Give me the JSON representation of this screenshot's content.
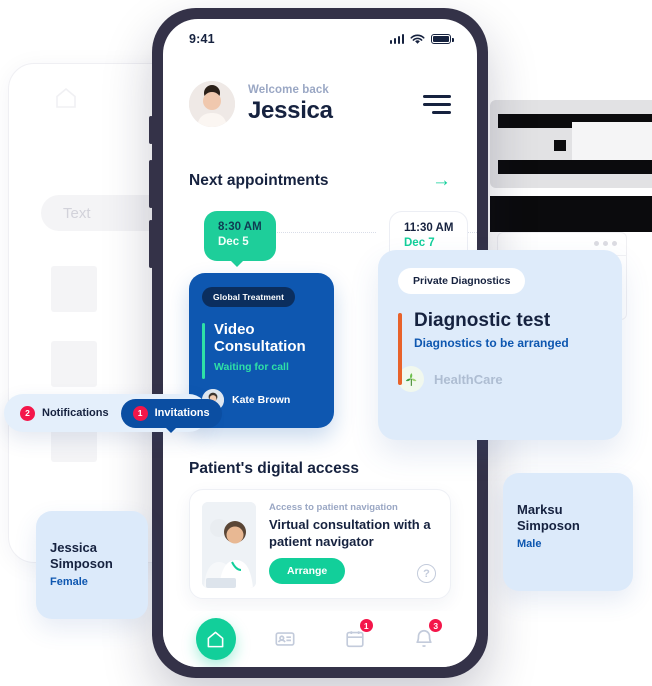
{
  "background": {
    "ghost_search_text": "Text",
    "ghost_home_icon": "home-icon"
  },
  "phone": {
    "status_bar": {
      "time": "9:41",
      "signal_icon": "cellular-signal-icon",
      "wifi_icon": "wifi-icon",
      "battery_icon": "battery-full-icon"
    },
    "header": {
      "avatar": "user-avatar",
      "welcome_label": "Welcome back",
      "user_name": "Jessica",
      "menu_icon": "hamburger-menu-icon"
    },
    "appointments": {
      "section_title": "Next appointments",
      "see_all_icon": "arrow-right-icon",
      "chips": [
        {
          "time": "8:30 AM",
          "date": "Dec 5"
        },
        {
          "time": "11:30 AM",
          "date": "Dec 7"
        }
      ],
      "blue_card": {
        "badge": "Global Treatment",
        "title": "Video Consultation",
        "status": "Waiting for call",
        "doctor": "Kate Brown",
        "accent_color": "#2ee0a6",
        "bg_color": "#0e57b0"
      },
      "ice_card": {
        "badge": "Private Diagnostics",
        "title": "Diagnostic test",
        "status": "Diagnostics to be arranged",
        "provider": "HealthCare",
        "provider_icon": "healthcare-logo-icon",
        "accent_color": "#e8622a",
        "bg_color": "#deebfa"
      }
    },
    "digital_access": {
      "section_title": "Patient's digital access",
      "card": {
        "image": "patient-navigator-photo",
        "eyebrow": "Access to patient navigation",
        "title": "Virtual consultation with a patient navigator",
        "button_label": "Arrange",
        "help_icon": "question-mark-icon"
      }
    },
    "bottom_nav": [
      {
        "icon": "home-icon",
        "badge": "",
        "active": true
      },
      {
        "icon": "id-card-icon",
        "badge": "",
        "active": false
      },
      {
        "icon": "calendar-icon",
        "badge": "1",
        "active": false
      },
      {
        "icon": "bell-icon",
        "badge": "3",
        "active": false
      }
    ]
  },
  "overlays": {
    "tabs_pill": [
      {
        "count": "2",
        "label": "Notifications",
        "active": false
      },
      {
        "count": "1",
        "label": "Invitations",
        "active": true
      }
    ],
    "patient_cards": [
      {
        "avatar": "patient-avatar-female",
        "name": "Jessica Simposon",
        "sex": "Female"
      },
      {
        "avatar": "patient-avatar-male",
        "name": "Marksu Simposon",
        "sex": "Male"
      }
    ]
  },
  "colors": {
    "green": "#12cf9a",
    "blue": "#0e57b0",
    "navy": "#16223f",
    "red_badge": "#f4164a",
    "frame": "#343248"
  }
}
